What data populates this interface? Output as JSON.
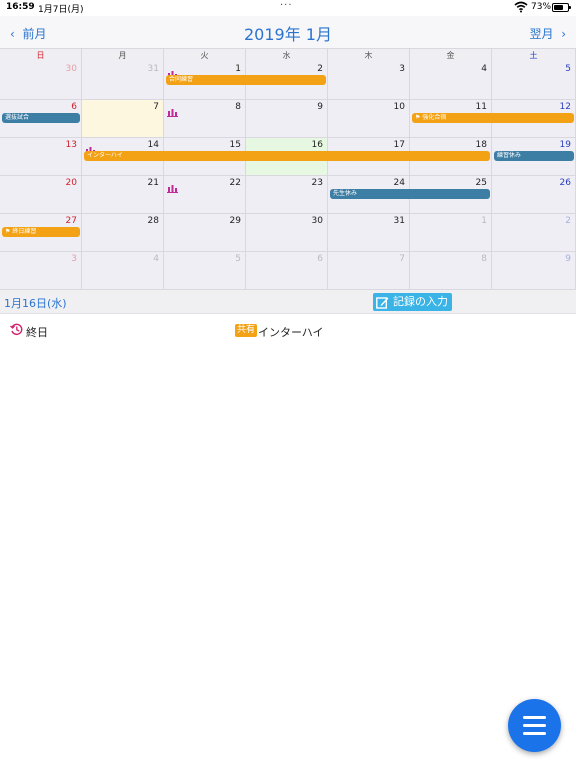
{
  "status": {
    "time": "16:59",
    "date": "1月7日(月)",
    "battery": "73%",
    "battery_level": 0.73
  },
  "nav": {
    "prev": "前月",
    "next": "翌月",
    "title": "2019年 1月"
  },
  "weekdays": [
    "日",
    "月",
    "火",
    "水",
    "木",
    "金",
    "土"
  ],
  "weeks": [
    [
      {
        "d": "30",
        "other": true
      },
      {
        "d": "31",
        "other": true
      },
      {
        "d": "1",
        "icon": true
      },
      {
        "d": "2"
      },
      {
        "d": "3"
      },
      {
        "d": "4"
      },
      {
        "d": "5"
      }
    ],
    [
      {
        "d": "6"
      },
      {
        "d": "7",
        "today": true
      },
      {
        "d": "8",
        "icon": true
      },
      {
        "d": "9"
      },
      {
        "d": "10"
      },
      {
        "d": "11"
      },
      {
        "d": "12"
      }
    ],
    [
      {
        "d": "13"
      },
      {
        "d": "14",
        "icon": true
      },
      {
        "d": "15"
      },
      {
        "d": "16",
        "selected": true
      },
      {
        "d": "17"
      },
      {
        "d": "18"
      },
      {
        "d": "19"
      }
    ],
    [
      {
        "d": "20"
      },
      {
        "d": "21"
      },
      {
        "d": "22",
        "icon": true
      },
      {
        "d": "23"
      },
      {
        "d": "24"
      },
      {
        "d": "25"
      },
      {
        "d": "26"
      }
    ],
    [
      {
        "d": "27"
      },
      {
        "d": "28"
      },
      {
        "d": "29"
      },
      {
        "d": "30"
      },
      {
        "d": "31"
      },
      {
        "d": "1",
        "other": true
      },
      {
        "d": "2",
        "other": true
      }
    ],
    [
      {
        "d": "3",
        "other": true
      },
      {
        "d": "4",
        "other": true
      },
      {
        "d": "5",
        "other": true
      },
      {
        "d": "6",
        "other": true
      },
      {
        "d": "7",
        "other": true
      },
      {
        "d": "8",
        "other": true
      },
      {
        "d": "9",
        "other": true
      }
    ]
  ],
  "events": [
    {
      "label": "合同練習",
      "week": 0,
      "start": 2,
      "span": 2,
      "color": "orange",
      "flag": false
    },
    {
      "label": "選抜試合",
      "week": 1,
      "start": 0,
      "span": 1,
      "color": "blue",
      "flag": false
    },
    {
      "label": "強化合宿",
      "week": 1,
      "start": 5,
      "span": 2,
      "color": "orange",
      "flag": true
    },
    {
      "label": "インターハイ",
      "week": 2,
      "start": 1,
      "span": 5,
      "color": "orange",
      "flag": false
    },
    {
      "label": "練習休み",
      "week": 2,
      "start": 6,
      "span": 1,
      "color": "blue",
      "flag": false
    },
    {
      "label": "先生休み",
      "week": 3,
      "start": 4,
      "span": 2,
      "color": "blue",
      "flag": false
    },
    {
      "label": "終日練習",
      "week": 4,
      "start": 0,
      "span": 1,
      "color": "orange",
      "flag": true
    }
  ],
  "detail": {
    "selected_date": "1月16日(水)",
    "record_button": "記録の入力",
    "allday_label": "終日",
    "tag_label": "共有",
    "event_name": "インターハイ"
  },
  "colors": {
    "accent": "#2a74d0",
    "orange": "#f3a215",
    "blue": "#3d7ea5",
    "sunday": "#d0202c",
    "saturday": "#2a3ec0",
    "fab": "#1a73e8"
  }
}
